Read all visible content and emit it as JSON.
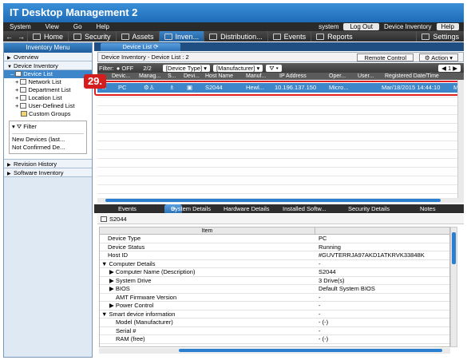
{
  "app": {
    "title": "IT Desktop Management 2"
  },
  "menubar": {
    "items": [
      "System",
      "View",
      "Go",
      "Help"
    ],
    "user": "system",
    "logout": "Log Out",
    "section": "Device Inventory",
    "help": "Help"
  },
  "toolbar": {
    "items": [
      {
        "label": "Home",
        "icon": "home-icon"
      },
      {
        "label": "Security",
        "icon": "lock-icon"
      },
      {
        "label": "Assets",
        "icon": "assets-icon"
      },
      {
        "label": "Inven...",
        "icon": "inventory-icon"
      },
      {
        "label": "Distribution...",
        "icon": "distribution-icon"
      },
      {
        "label": "Events",
        "icon": "events-icon"
      },
      {
        "label": "Reports",
        "icon": "reports-icon"
      },
      {
        "label": "Settings",
        "icon": "settings-icon"
      }
    ]
  },
  "left": {
    "header": "Inventory Menu",
    "overview": "Overview",
    "device_inventory": "Device Inventory",
    "tree": [
      "Device List",
      "Network List",
      "Department List",
      "Location List",
      "User-Defined List",
      "Custom Groups"
    ],
    "filter": "Filter",
    "filter_items": [
      "New Devices (last...",
      "Not Confirmed De..."
    ],
    "revision": "Revision History",
    "software": "Software Inventory"
  },
  "tab": {
    "label": "Device List"
  },
  "panel": {
    "title": "Device Inventory - Device List : 2",
    "remote": "Remote Control",
    "action": "Action"
  },
  "filterbar": {
    "label": "Filter",
    "state": "OFF",
    "count": "2/2",
    "device_type": "[Device Type]",
    "manufacturer": "[Manufacturer]",
    "page": "1"
  },
  "columns": [
    "Devic...",
    "Manag...",
    "S...",
    "Devi...",
    "Host Name",
    "Manuf...",
    "IP Address",
    "Oper...",
    "User...",
    "Registered Date/Time"
  ],
  "row": {
    "device": "PC",
    "host": "S2044",
    "manufacturer": "Hewl...",
    "ip": "10.196.137.150",
    "os": "Micro...",
    "date": "Mar/18/2015 14:44:10",
    "extra": "M"
  },
  "callout": "29.",
  "bottom_tabs": [
    "Events",
    "System Details",
    "Hardware Details",
    "Installed Softw...",
    "Security Details",
    "Notes"
  ],
  "host": "S2044",
  "details": {
    "item_header": "Item",
    "rows": [
      {
        "item": "Device Type",
        "value": "PC"
      },
      {
        "item": "Device Status",
        "value": "Running"
      },
      {
        "item": "Host ID",
        "value": "#GUVTERRJA97AKD1ATKRVK33848K"
      },
      {
        "item": "Computer Details",
        "value": "-"
      },
      {
        "item": "Computer Name (Description)",
        "value": "S2044"
      },
      {
        "item": "System Drive",
        "value": "3 Drive(s)"
      },
      {
        "item": "BIOS",
        "value": "Default System BIOS"
      },
      {
        "item": "AMT Firmware Version",
        "value": "-"
      },
      {
        "item": "Power Control",
        "value": "-"
      },
      {
        "item": "Smart device information",
        "value": "-"
      },
      {
        "item": "Model (Manufacturer)",
        "value": "- (-)"
      },
      {
        "item": "Serial #",
        "value": "-"
      },
      {
        "item": "RAM (free)",
        "value": "- (-)"
      }
    ]
  }
}
